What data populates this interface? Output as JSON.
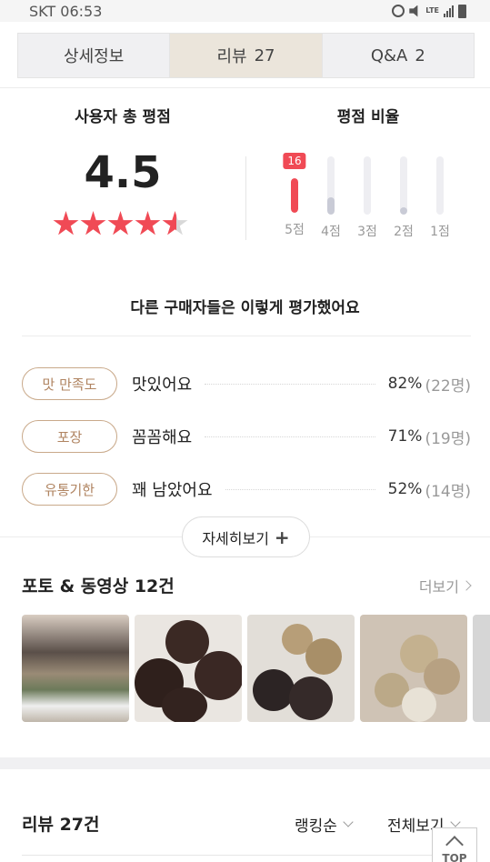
{
  "status_bar": {
    "carrier_time": "SKT 06:53",
    "network_label": "LTE",
    "icons": [
      "alarm-icon",
      "mute-icon",
      "lte-icon",
      "signal-icon",
      "battery-icon"
    ]
  },
  "tabs": [
    {
      "label": "상세정보",
      "count": "",
      "active": false
    },
    {
      "label": "리뷰",
      "count": "27",
      "active": true
    },
    {
      "label": "Q&A",
      "count": "2",
      "active": false
    }
  ],
  "rating": {
    "title": "사용자 총 평점",
    "score": "4.5",
    "stars_value": 4.5,
    "stars_max": 5,
    "star_color": "#f04a55"
  },
  "ratio": {
    "title": "평점 비율",
    "items": [
      {
        "label": "5점",
        "fill": 0.62,
        "badge": "16",
        "top": true
      },
      {
        "label": "4점",
        "fill": 0.3,
        "badge": "",
        "top": false
      },
      {
        "label": "3점",
        "fill": 0.0,
        "badge": "",
        "top": false
      },
      {
        "label": "2점",
        "fill": 0.12,
        "badge": "",
        "top": false
      },
      {
        "label": "1점",
        "fill": 0.0,
        "badge": "",
        "top": false
      }
    ]
  },
  "evaluation": {
    "title": "다른 구매자들은 이렇게 평가했어요",
    "rows": [
      {
        "tag": "맛 만족도",
        "text": "맛있어요",
        "percent": "82%",
        "count": "(22명)"
      },
      {
        "tag": "포장",
        "text": "꼼꼼해요",
        "percent": "71%",
        "count": "(19명)"
      },
      {
        "tag": "유통기한",
        "text": "꽤 남았어요",
        "percent": "52%",
        "count": "(14명)"
      }
    ],
    "more_label": "자세히보기"
  },
  "photos": {
    "title": "포토 & 동영상 12건",
    "more_label": "더보기"
  },
  "reviews": {
    "title": "리뷰 27건",
    "sort_label": "랭킹순",
    "filter_label": "전체보기"
  },
  "top_button": {
    "label": "TOP"
  },
  "colors": {
    "accent": "#f04a55",
    "tag_border": "#c9a98a",
    "active_tab": "#ebe5db"
  }
}
